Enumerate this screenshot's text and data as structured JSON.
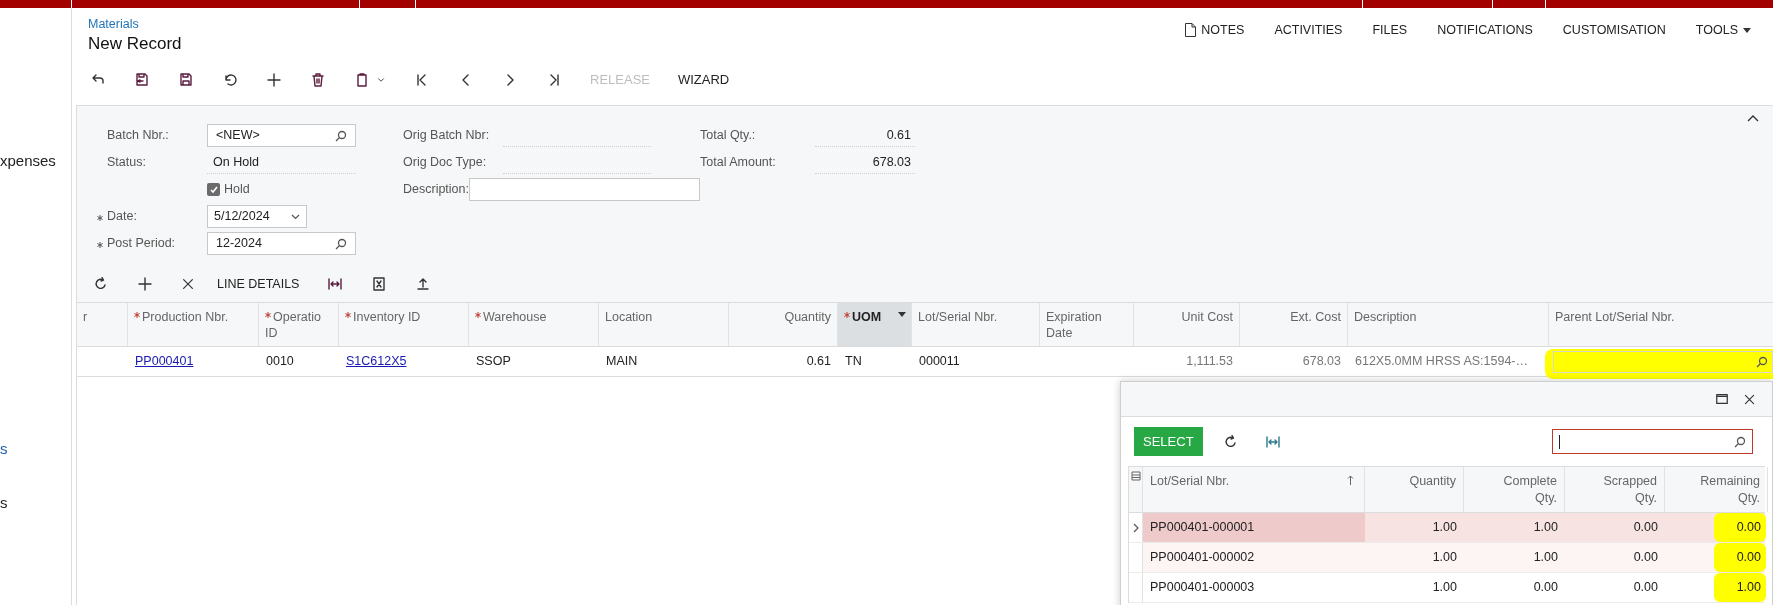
{
  "sidebar": {
    "items": [
      {
        "label": "xpenses",
        "selected": false
      },
      {
        "label": "s",
        "selected": true
      },
      {
        "label": "s",
        "selected": false
      }
    ]
  },
  "breadcrumb": "Materials",
  "title": "New Record",
  "top_actions": [
    {
      "label": "NOTES",
      "kind": "note"
    },
    {
      "label": "ACTIVITIES",
      "kind": "plain"
    },
    {
      "label": "FILES",
      "kind": "plain"
    },
    {
      "label": "NOTIFICATIONS",
      "kind": "plain"
    },
    {
      "label": "CUSTOMISATION",
      "kind": "plain"
    },
    {
      "label": "TOOLS",
      "kind": "dropdown"
    }
  ],
  "toolbar": {
    "buttons": [
      {
        "label": "RELEASE",
        "disabled": true
      },
      {
        "label": "WIZARD",
        "disabled": false
      }
    ]
  },
  "form": {
    "left": [
      {
        "label": "Batch Nbr.:",
        "kind": "lookup",
        "value": "<NEW>"
      },
      {
        "label": "Status:",
        "kind": "text",
        "value": "On Hold"
      },
      {
        "label": "Hold",
        "kind": "checkbox",
        "checked": true
      },
      {
        "label": "Date:",
        "kind": "date",
        "value": "5/12/2024",
        "required": true
      },
      {
        "label": "Post Period:",
        "kind": "lookup",
        "value": "12-2024",
        "required": true
      }
    ],
    "middle": [
      {
        "label": "Orig Batch Nbr:",
        "kind": "text"
      },
      {
        "label": "Orig Doc Type:",
        "kind": "text"
      },
      {
        "label": "Description:",
        "kind": "input"
      }
    ],
    "right": [
      {
        "label": "Total Qty.:",
        "value": "0.61"
      },
      {
        "label": "Total Amount:",
        "value": "678.03"
      }
    ]
  },
  "grid": {
    "toolbar": {
      "button": "LINE DETAILS"
    },
    "columns": [
      {
        "label": "r",
        "required": false,
        "active": false,
        "kind": "text"
      },
      {
        "label": "Production Nbr.",
        "required": true,
        "active": false,
        "kind": "link"
      },
      {
        "label": "Operatio ID",
        "required": true,
        "active": false,
        "kind": "text"
      },
      {
        "label": "Inventory ID",
        "required": true,
        "active": false,
        "kind": "link"
      },
      {
        "label": "Warehouse",
        "required": true,
        "active": false,
        "kind": "text"
      },
      {
        "label": "Location",
        "required": false,
        "active": false,
        "kind": "text"
      },
      {
        "label": "Quantity",
        "required": false,
        "active": false,
        "kind": "number"
      },
      {
        "label": "UOM",
        "required": true,
        "active": true,
        "kind": "text"
      },
      {
        "label": "Lot/Serial Nbr.",
        "required": false,
        "active": false,
        "kind": "text"
      },
      {
        "label": "Expiration Date",
        "required": false,
        "active": false,
        "kind": "text"
      },
      {
        "label": "Unit Cost",
        "required": false,
        "active": false,
        "kind": "readonly_number"
      },
      {
        "label": "Ext. Cost",
        "required": false,
        "active": false,
        "kind": "readonly_number"
      },
      {
        "label": "Description",
        "required": false,
        "active": false,
        "kind": "readonly_text"
      },
      {
        "label": "Parent Lot/Serial Nbr.",
        "required": false,
        "active": false,
        "kind": "lookup"
      }
    ],
    "rows": [
      {
        "cells": [
          null,
          "PP000401",
          "0010",
          "S1C612X5",
          "SSOP",
          "MAIN",
          "0.61",
          "TN",
          "000011",
          null,
          "1,111.53",
          "678.03",
          "612X5.0MM HRSS AS:1594-…",
          null
        ],
        "parent_lot": {
          "kind": "lookup",
          "highlighted": true
        }
      }
    ]
  },
  "popup": {
    "select_button": "SELECT",
    "columns": [
      {
        "label": "Lot/Serial Nbr.",
        "kind": "text",
        "sorted": true
      },
      {
        "label": "Quantity",
        "kind": "number",
        "sorted": false
      },
      {
        "label": "Complete Qty.",
        "kind": "number",
        "sorted": false
      },
      {
        "label": "Scrapped Qty.",
        "kind": "number",
        "sorted": false
      },
      {
        "label": "Remaining Qty.",
        "kind": "number",
        "sorted": false
      }
    ],
    "rows": [
      {
        "cells": [
          "PP000401-000001",
          "1.00",
          "1.00",
          "0.00",
          "0.00"
        ],
        "selected": true,
        "highlighted": true
      },
      {
        "cells": [
          "PP000401-000002",
          "1.00",
          "1.00",
          "0.00",
          "0.00"
        ],
        "selected": false,
        "highlighted": true
      },
      {
        "cells": [
          "PP000401-000003",
          "1.00",
          "0.00",
          "0.00",
          "1.00"
        ],
        "selected": false,
        "highlighted": true
      }
    ]
  }
}
